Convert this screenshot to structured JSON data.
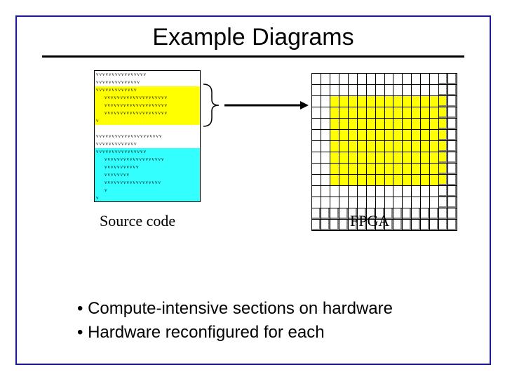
{
  "title": "Example Diagrams",
  "source_code": {
    "label": "Source code",
    "lines": [
      {
        "text": "vvvvvvvvvvvvvvvv",
        "style": "plain",
        "indent": false
      },
      {
        "text": "vvvvvvvvvvvvvv",
        "style": "plain",
        "indent": false
      },
      {
        "text": "vvvvvvvvvvvvv",
        "style": "yellow",
        "indent": false
      },
      {
        "text": "vvvvvvvvvvvvvvvvvvvv",
        "style": "yellow",
        "indent": true
      },
      {
        "text": "vvvvvvvvvvvvvvvvvvvv",
        "style": "yellow",
        "indent": true
      },
      {
        "text": "vvvvvvvvvvvvvvvvvvvv",
        "style": "yellow",
        "indent": true
      },
      {
        "text": "v",
        "style": "yellow",
        "indent": false
      },
      {
        "text": "",
        "style": "plain",
        "indent": false
      },
      {
        "text": "vvvvvvvvvvvvvvvvvvvvv",
        "style": "plain",
        "indent": false
      },
      {
        "text": "vvvvvvvvvvvvv",
        "style": "plain",
        "indent": false
      },
      {
        "text": "vvvvvvvvvvvvvvvv",
        "style": "cyan",
        "indent": false
      },
      {
        "text": "vvvvvvvvvvvvvvvvvvv",
        "style": "cyan",
        "indent": true
      },
      {
        "text": "vvvvvvvvvvv",
        "style": "cyan",
        "indent": true
      },
      {
        "text": "vvvvvvvv",
        "style": "cyan",
        "indent": true
      },
      {
        "text": "vvvvvvvvvvvvvvvvvv",
        "style": "cyan",
        "indent": true
      },
      {
        "text": "v",
        "style": "cyan",
        "indent": true
      },
      {
        "text": "v",
        "style": "cyan",
        "indent": false
      }
    ]
  },
  "fpga": {
    "label": "FPGA",
    "rows": 14,
    "cols": 16,
    "highlighted": {
      "row_start": 2,
      "row_end": 9,
      "col_start": 2,
      "col_end": 14
    }
  },
  "bullets": [
    "Compute-intensive sections on hardware",
    "Hardware reconfigured for each"
  ]
}
